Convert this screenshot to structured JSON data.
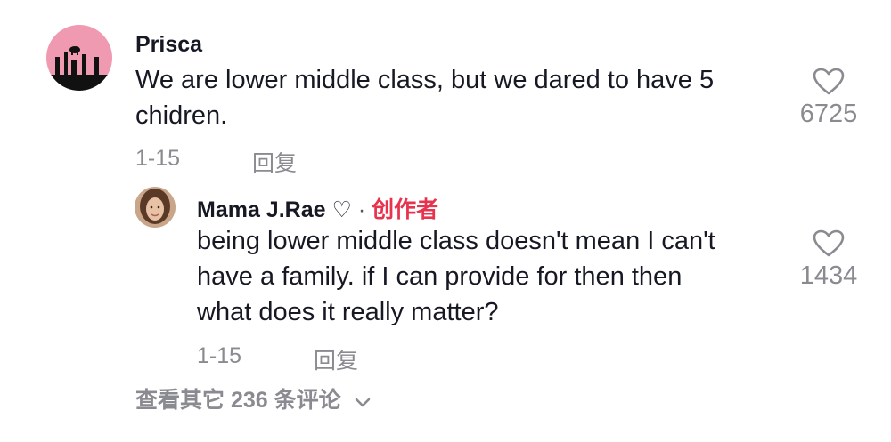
{
  "comment": {
    "username": "Prisca",
    "text_line1": "We are lower middle class, but we dared to have 5",
    "text_line2": "chidren.",
    "date": "1-15",
    "reply_label": "回复",
    "likes": "6725",
    "avatar_bg": "#ef9ab0"
  },
  "reply": {
    "username": "Mama J.Rae",
    "username_suffix": "♡",
    "separator": "·",
    "creator_label": "创作者",
    "text_line1": "being lower middle class doesn't mean I can't",
    "text_line2": "have a family. if I can provide for then then",
    "text_line3": "what does it really matter?",
    "date": "1-15",
    "reply_label": "回复",
    "likes": "1434"
  },
  "view_more": {
    "label": "查看其它 236 条评论"
  },
  "colors": {
    "creator_accent": "#e8334f",
    "meta_gray": "#8a8b91",
    "text_dark": "#161823"
  }
}
